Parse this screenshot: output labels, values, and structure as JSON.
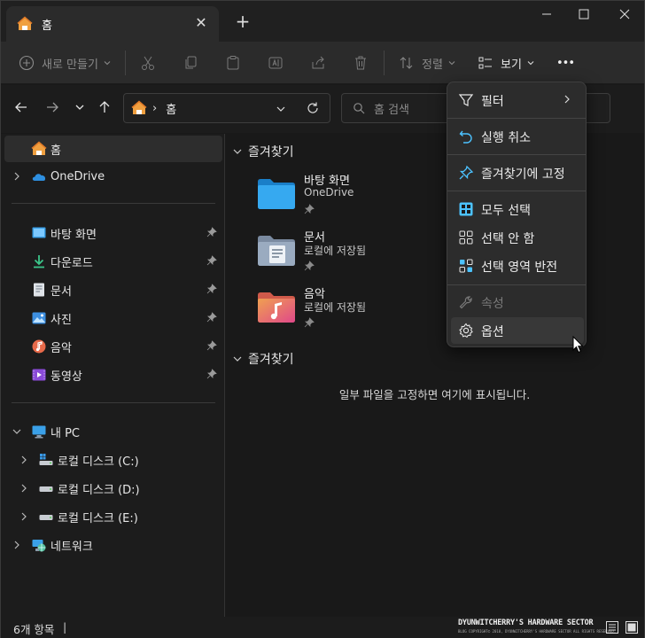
{
  "window": {
    "tab_title": "홈",
    "tab_close": "✕",
    "new_tab": "+",
    "min": "—",
    "max": "☐",
    "close": "✕"
  },
  "toolbar": {
    "new_label": "새로 만들기",
    "sort_label": "정렬",
    "view_label": "보기",
    "more_label": "•••"
  },
  "address": {
    "sep": "›",
    "crumb": "홈",
    "search_placeholder": "홈 검색"
  },
  "sidebar": {
    "home": "홈",
    "onedrive": "OneDrive",
    "pinned": [
      {
        "label": "바탕 화면"
      },
      {
        "label": "다운로드"
      },
      {
        "label": "문서"
      },
      {
        "label": "사진"
      },
      {
        "label": "음악"
      },
      {
        "label": "동영상"
      }
    ],
    "this_pc": "내 PC",
    "drives": [
      {
        "label": "로컬 디스크 (C:)"
      },
      {
        "label": "로컬 디스크 (D:)"
      },
      {
        "label": "로컬 디스크 (E:)"
      }
    ],
    "network": "네트워크"
  },
  "main": {
    "quick_access_header": "즐겨찾기",
    "favorites_header": "즐겨찾기",
    "items": [
      {
        "name": "바탕 화면",
        "sub": "OneDrive"
      },
      {
        "name": "문서",
        "sub": "로컬에 저장됨"
      },
      {
        "name": "음악",
        "sub": "로컬에 저장됨"
      }
    ],
    "empty_message": "일부 파일을 고정하면 여기에 표시됩니다."
  },
  "menu": {
    "filter": "필터",
    "undo": "실행 취소",
    "pin_quick": "즐겨찾기에 고정",
    "select_all": "모두 선택",
    "select_none": "선택 안 함",
    "invert": "선택 영역 반전",
    "properties": "속성",
    "options": "옵션"
  },
  "status": {
    "count": "6개 항목",
    "caret": "|",
    "watermark": "DYUNWITCHERRY'S HARDWARE SECTOR",
    "watermark_sub": "BLOG COPYRIGHT© 2010, DYUNWITCHERRY'S HARDWARE SECTOR ALL RIGHTS RESERVED."
  },
  "colors": {
    "accent": "#4cc2ff",
    "menu_bg": "#2c2c2c",
    "window_bg": "#191919"
  }
}
